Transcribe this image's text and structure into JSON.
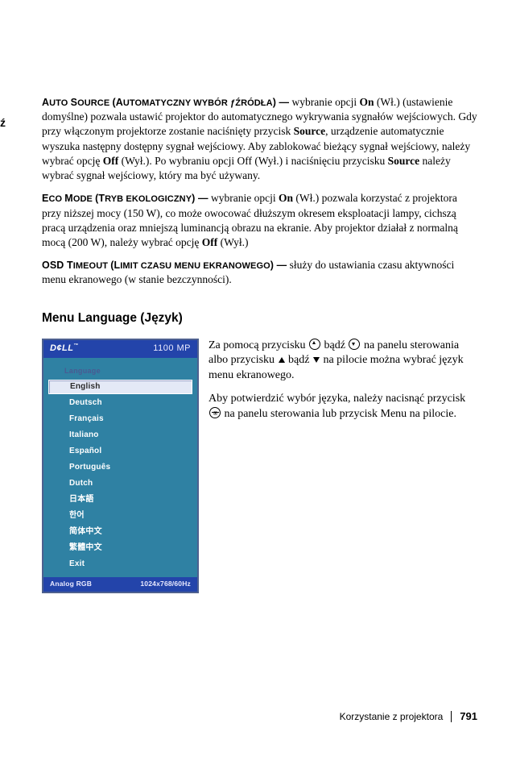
{
  "crop_label": "ź",
  "paragraphs": {
    "auto_source": {
      "label": "AUTO SOURCE (AUTOMATYCZNY WYBÓR ƒŹRÓDŁA) —",
      "text": " wybranie opcji ",
      "on": "On",
      "text2": " (Wł.) (ustawienie domyślne) pozwala ustawić projektor do automatycznego wykrywania sygnałów wejściowych. Gdy przy włączonym projektorze zostanie naciśnięty przycisk ",
      "source": "Source",
      "text3": ", urządzenie automatycznie wyszuka następny dostępny sygnał wejściowy. Aby zablokować bieżący sygnał wejściowy, należy wybrać opcję ",
      "off": "Off",
      "text4": " (Wył.). Po wybraniu opcji Off (Wył.) i naciśnięciu przycisku ",
      "source2": "Source",
      "text5": " należy wybrać sygnał wejściowy, który ma być używany."
    },
    "eco_mode": {
      "label": "ECO MODE (TRYB EKOLOGICZNY) —",
      "text": " wybranie opcji ",
      "on": "On",
      "text2": " (Wł.) pozwala korzystać z projektora przy niższej mocy (150 W), co może owocować dłuższym okresem eksploatacji lampy, cichszą pracą urządzenia oraz mniejszą luminancją obrazu na ekranie. Aby projektor działał z normalną mocą (200 W), należy wybrać opcję ",
      "off": "Off",
      "text3": " (Wył.)"
    },
    "osd_timeout": {
      "label": "OSD TIMEOUT (LIMIT CZASU MENU EKRANOWEGO)  —",
      "text": " służy do ustawiania czasu aktywności menu ekranowego (w stanie bezczynności)."
    }
  },
  "heading": "Menu Language (Język)",
  "menu": {
    "brand": "D¢LL",
    "tm": "™",
    "model": "1100 MP",
    "section": "Language",
    "items": [
      "English",
      "Deutsch",
      "Français",
      "Italiano",
      "Español",
      "Português",
      "Dutch",
      "日本語",
      "한어",
      "简体中文",
      "繁體中文",
      "Exit"
    ],
    "selected_index": 0,
    "status_left": "Analog RGB",
    "status_right": "1024x768/60Hz"
  },
  "right": {
    "p1a": "Za pomocą przycisku ",
    "p1b": " bądź ",
    "p1c": " na panelu sterowania albo przycisku ",
    "p1d": " bądź ",
    "p1e": " na pilocie można wybrać język menu ekranowego.",
    "p2a": "Aby potwierdzić wybór języka, należy nacisnąć przycisk ",
    "p2b": "  na panelu sterowania lub przycisk Menu na pilocie."
  },
  "footer": {
    "text": "Korzystanie z projektora",
    "page": "791"
  }
}
